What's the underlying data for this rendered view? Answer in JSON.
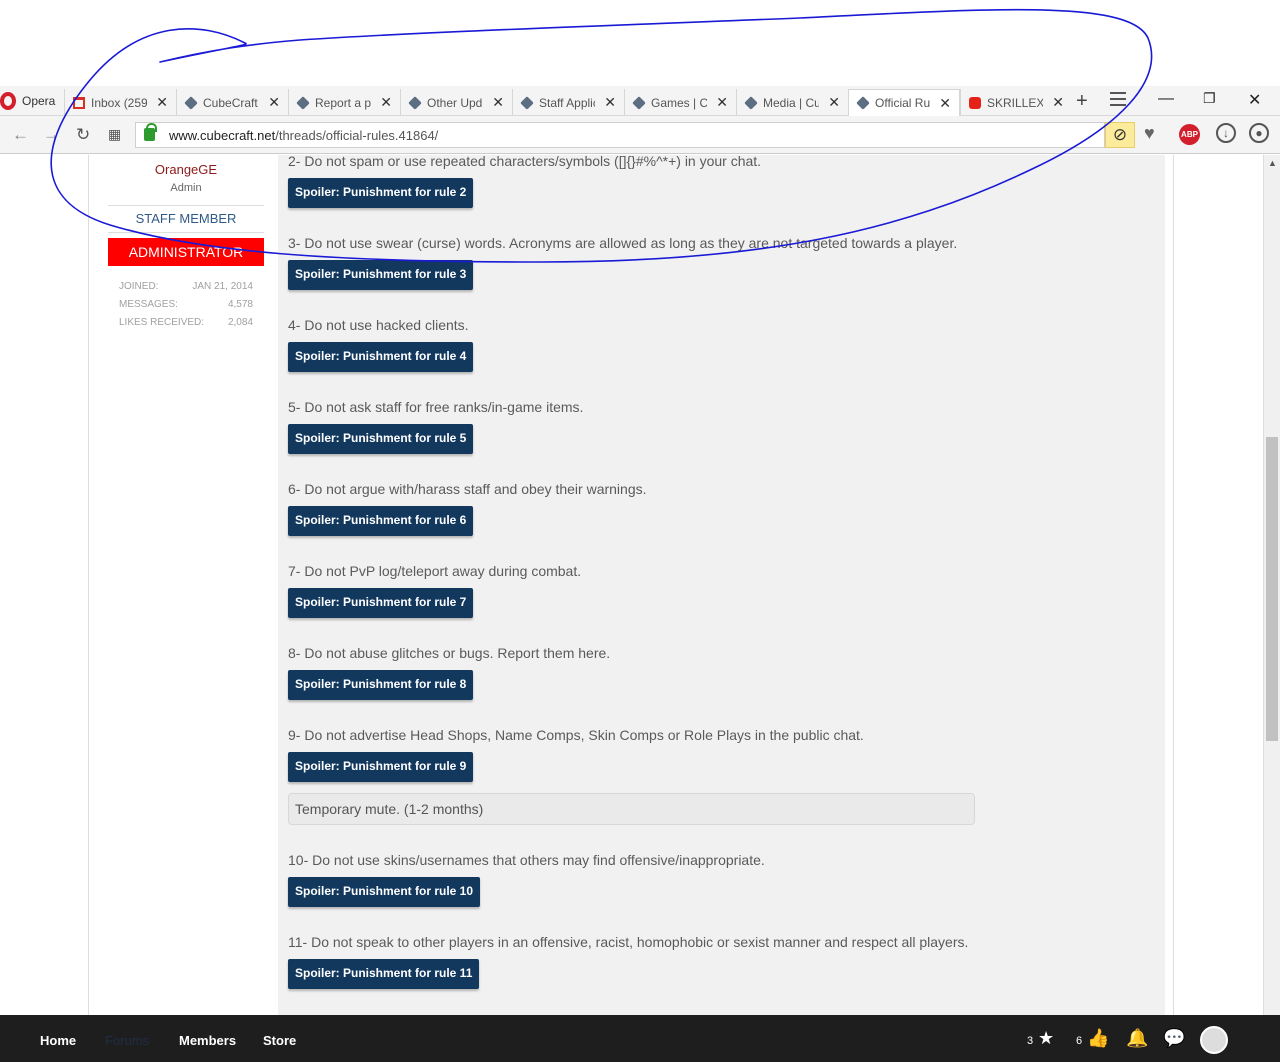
{
  "browser": {
    "brand": "Opera",
    "tabs": [
      {
        "title": "Inbox (259",
        "favicon": "gmail"
      },
      {
        "title": "CubeCraft",
        "favicon": "cube"
      },
      {
        "title": "Report a pl",
        "favicon": "cube"
      },
      {
        "title": "Other Upd",
        "favicon": "cube"
      },
      {
        "title": "Staff Applic",
        "favicon": "cube"
      },
      {
        "title": "Games | Cu",
        "favicon": "cube"
      },
      {
        "title": "Media | Cu",
        "favicon": "cube"
      },
      {
        "title": "Official Ru",
        "favicon": "cube",
        "active": true
      },
      {
        "title": "SKRILLEX",
        "favicon": "youtube"
      }
    ],
    "url_host": "www.cubecraft.net",
    "url_path": "/threads/official-rules.41864/",
    "extensions": [
      "ad-blocker-icon",
      "heart-icon",
      "abp-icon",
      "download-icon",
      "account-icon"
    ],
    "abp_label": "ABP"
  },
  "sidebar": {
    "username": "OrangeGE",
    "user_title": "Admin",
    "staff_label": "STAFF MEMBER",
    "badge": "ADMINISTRATOR",
    "badge_color": "#ff0000",
    "stats": [
      {
        "label": "JOINED:",
        "value": "JAN 21, 2014"
      },
      {
        "label": "MESSAGES:",
        "value": "4,578"
      },
      {
        "label": "LIKES RECEIVED:",
        "value": "2,084"
      }
    ]
  },
  "rules": [
    {
      "text": "2- Do not spam or use repeated characters/symbols ([]{}#%^*+) in your chat.",
      "spoiler": "Spoiler: Punishment for rule 2"
    },
    {
      "text": "3- Do not use swear (curse) words. Acronyms are allowed as long as they are not targeted towards a player.",
      "spoiler": "Spoiler: Punishment for rule 3"
    },
    {
      "text": "4- Do not use hacked clients.",
      "spoiler": "Spoiler: Punishment for rule 4"
    },
    {
      "text": "5- Do not ask staff for free ranks/in-game items.",
      "spoiler": "Spoiler: Punishment for rule 5"
    },
    {
      "text": "6- Do not argue with/harass staff and obey their warnings.",
      "spoiler": "Spoiler: Punishment for rule 6"
    },
    {
      "text": "7- Do not PvP log/teleport away during combat.",
      "spoiler": "Spoiler: Punishment for rule 7"
    },
    {
      "text": "8- Do not abuse glitches or bugs. Report them here.",
      "spoiler": "Spoiler: Punishment for rule 8"
    },
    {
      "text": "9- Do not advertise Head Shops, Name Comps, Skin Comps or Role Plays in the public chat.",
      "spoiler": "Spoiler: Punishment for rule 9",
      "revealed": "Temporary mute. (1-2 months)"
    },
    {
      "text": "10- Do not use skins/usernames that others may find offensive/inappropriate.",
      "spoiler": "Spoiler: Punishment for rule 10"
    },
    {
      "text": "11- Do not speak to other players in an offensive, racist, homophobic or sexist manner and respect all players.",
      "spoiler": "Spoiler: Punishment for rule 11"
    }
  ],
  "colors": {
    "spoiler_bg": "#12385e",
    "content_bg": "#f1f1f1",
    "nav_bg": "#1e1e1e",
    "annotation": "#1a1ad6"
  },
  "bottom_nav": {
    "links": [
      "Home",
      "Forums",
      "Members",
      "Store"
    ],
    "active": "Forums",
    "ratings_count": "3",
    "likes_count": "6",
    "icons": [
      "star-icon",
      "thumbs-up-icon",
      "bell-icon",
      "chat-icon",
      "avatar"
    ]
  }
}
